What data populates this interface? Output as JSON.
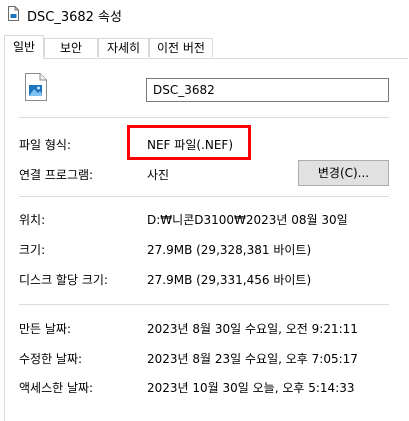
{
  "window": {
    "title": "DSC_3682 속성",
    "icon": "document-icon"
  },
  "tabs": [
    {
      "label": "일반",
      "active": true
    },
    {
      "label": "보안",
      "active": false
    },
    {
      "label": "자세히",
      "active": false
    },
    {
      "label": "이전 버전",
      "active": false
    }
  ],
  "general": {
    "file_icon": "image-file-icon",
    "file_name": "DSC_3682",
    "file_type_label": "파일 형식:",
    "file_type_value": "NEF 파일(.NEF)",
    "opens_with_label": "연결 프로그램:",
    "opens_with_value": "사진",
    "change_button": "변경(C)...",
    "location_label": "위치:",
    "location_value": "D:₩니콘D3100₩2023년 08월 30일",
    "size_label": "크기:",
    "size_value": "27.9MB (29,328,381 바이트)",
    "size_on_disk_label": "디스크 할당 크기:",
    "size_on_disk_value": "27.9MB (29,331,456 바이트)",
    "created_label": "만든 날짜:",
    "created_value": "2023년 8월 30일 수요일, 오전 9:21:11",
    "modified_label": "수정한 날짜:",
    "modified_value": "2023년 8월 23일 수요일, 오후 7:05:17",
    "accessed_label": "액세스한 날짜:",
    "accessed_value": "2023년 10월 30일 오늘, 오후 5:14:33"
  },
  "colors": {
    "highlight": "#ff0000",
    "icon_blue": "#1e73be"
  }
}
